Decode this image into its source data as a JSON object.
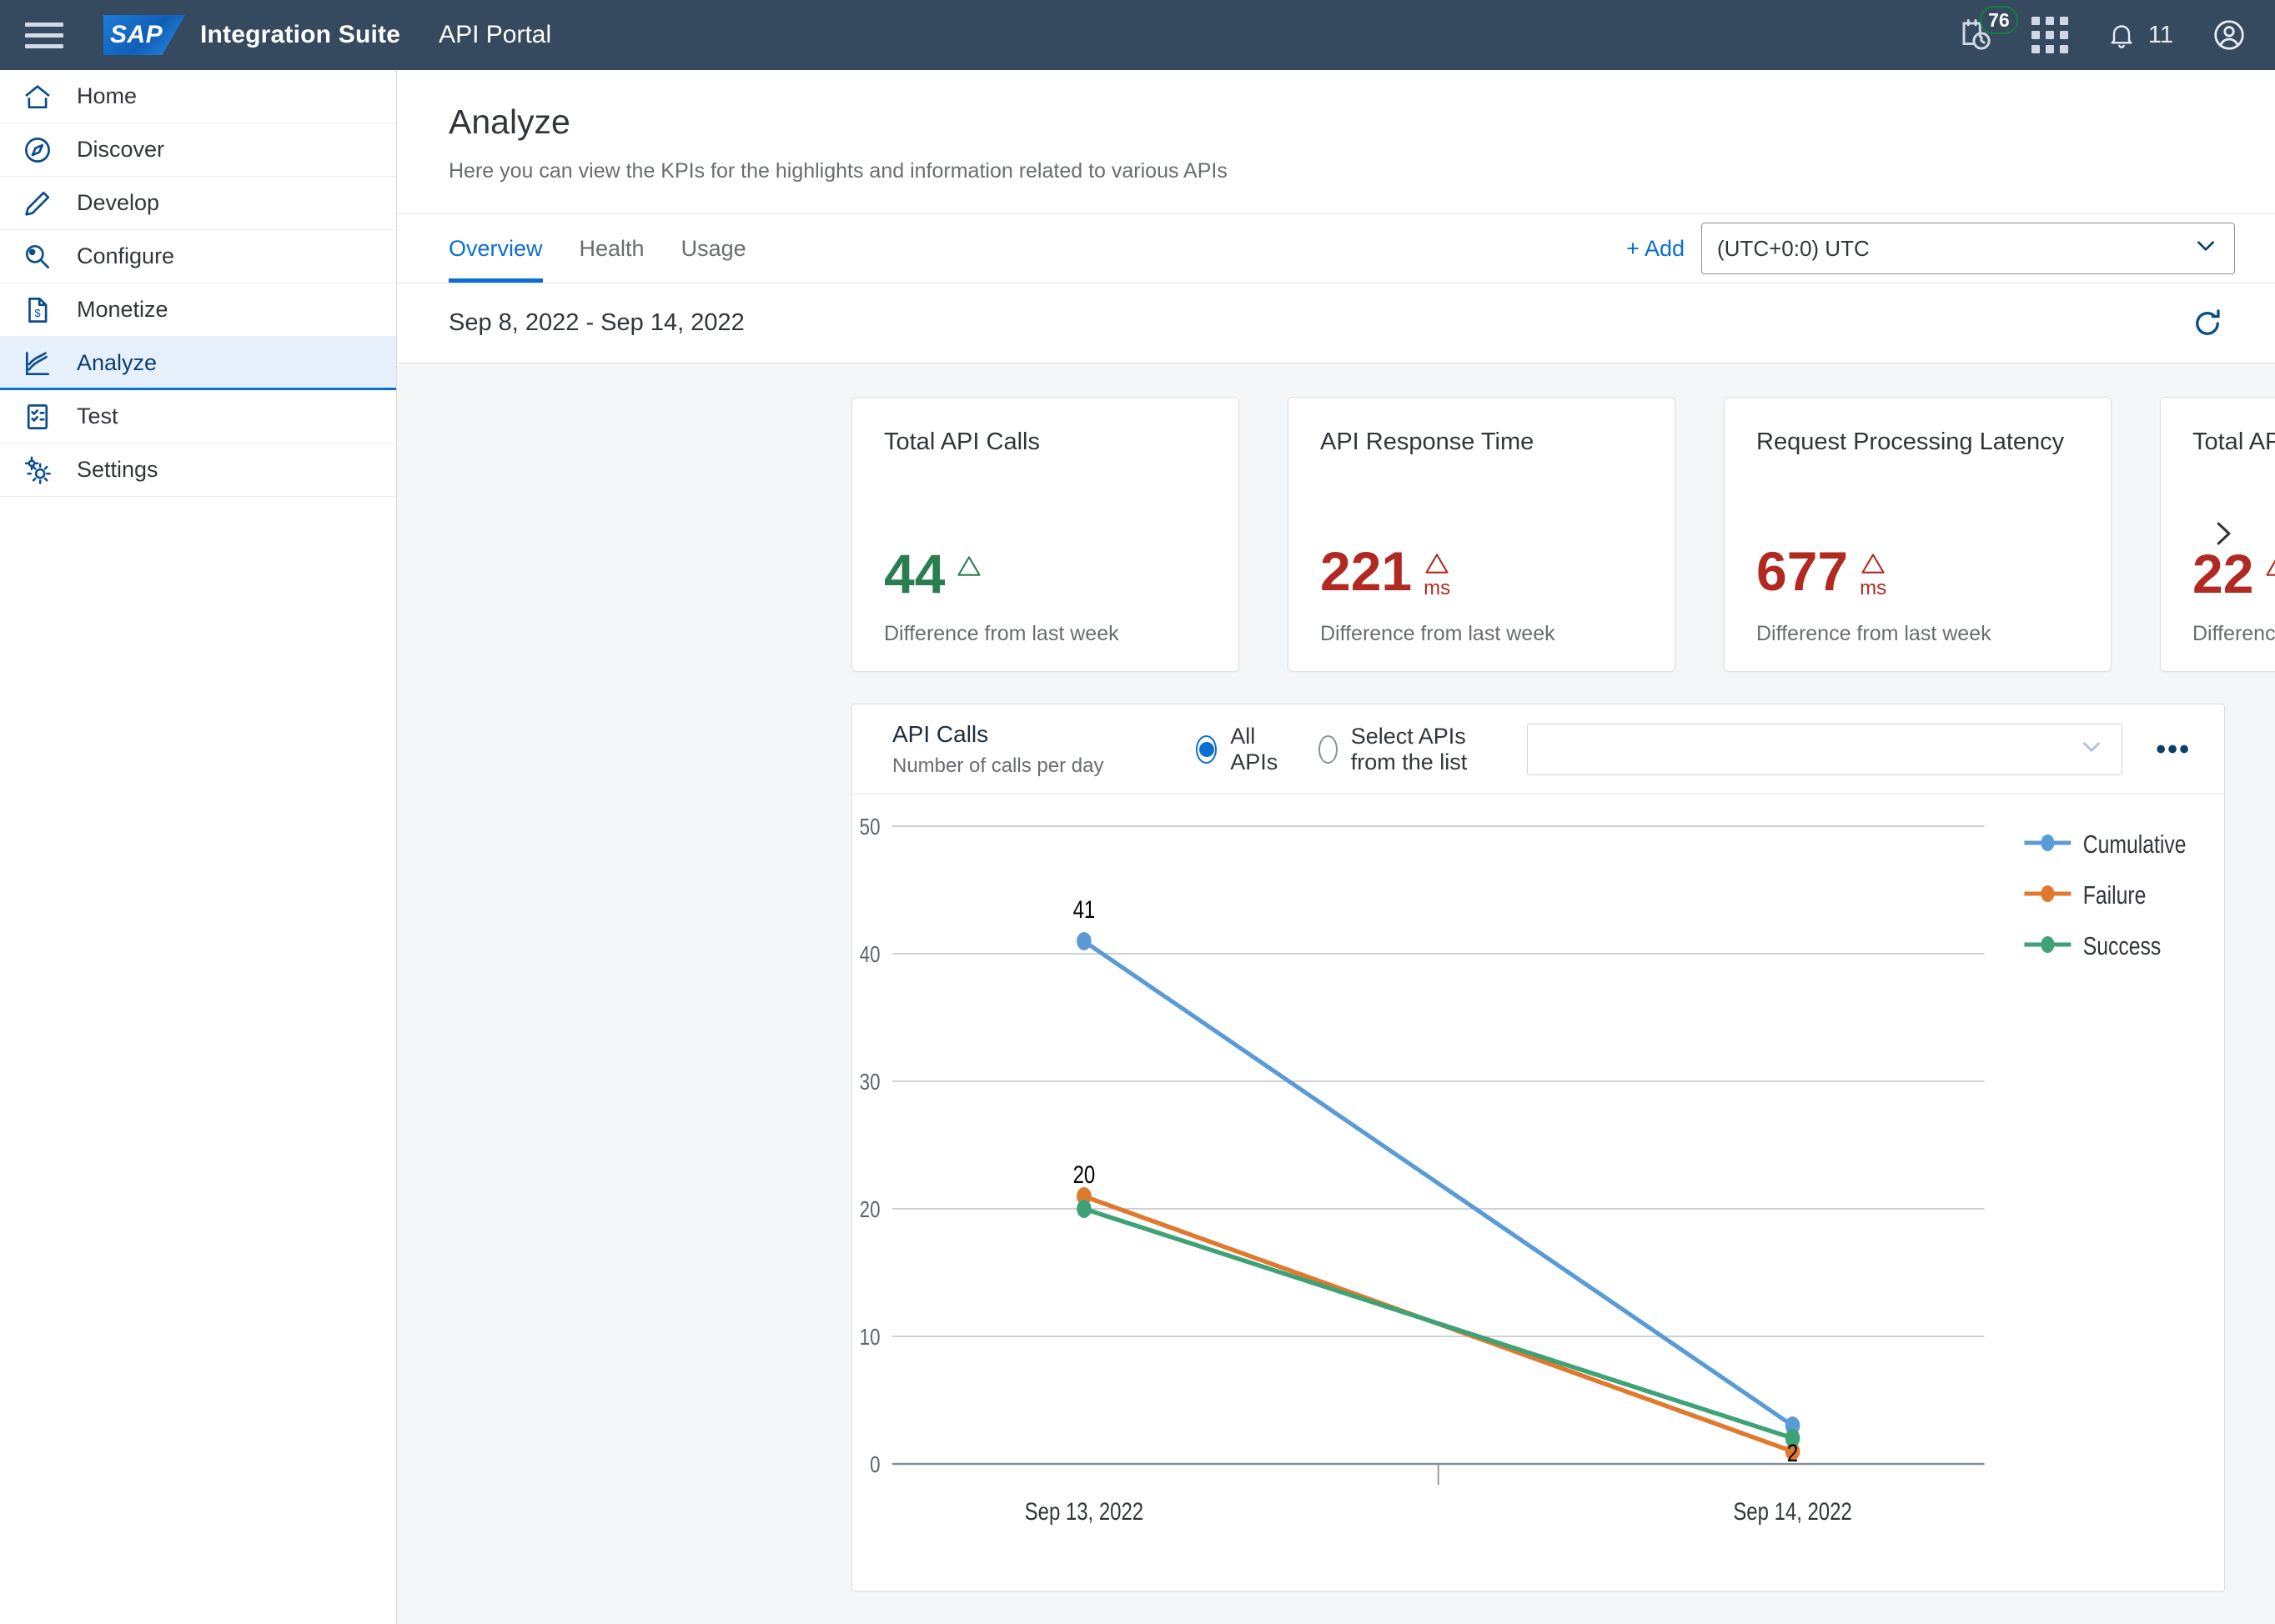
{
  "header": {
    "menu_icon": "hamburger-menu-icon",
    "logo_text": "SAP",
    "product": "Integration Suite",
    "section": "API Portal",
    "schedule_badge": "76",
    "schedule_icon": "calendar-clock-icon",
    "apps_icon": "app-grid-icon",
    "notifications_icon": "bell-icon",
    "notifications_count": "11",
    "account_icon": "user-avatar-icon"
  },
  "sidebar": {
    "items": [
      {
        "label": "Home",
        "icon": "home-icon",
        "active": false
      },
      {
        "label": "Discover",
        "icon": "compass-icon",
        "active": false
      },
      {
        "label": "Develop",
        "icon": "pencil-icon",
        "active": false
      },
      {
        "label": "Configure",
        "icon": "magnifier-gear-icon",
        "active": false
      },
      {
        "label": "Monetize",
        "icon": "document-dollar-icon",
        "active": false
      },
      {
        "label": "Analyze",
        "icon": "line-chart-icon",
        "active": true
      },
      {
        "label": "Test",
        "icon": "checklist-icon",
        "active": false
      },
      {
        "label": "Settings",
        "icon": "gears-icon",
        "active": false
      }
    ]
  },
  "page": {
    "title": "Analyze",
    "subtitle": "Here you can view the KPIs for the highlights and information related to various APIs",
    "tabs": [
      {
        "label": "Overview",
        "active": true
      },
      {
        "label": "Health",
        "active": false
      },
      {
        "label": "Usage",
        "active": false
      }
    ],
    "add_label": "+ Add",
    "timezone": "(UTC+0:0) UTC",
    "timezone_chevron": "chevron-down-icon",
    "date_range": "Sep 8, 2022 - Sep 14, 2022",
    "refresh_icon": "refresh-icon",
    "kpi_next_icon": "chevron-right-icon"
  },
  "kpis": [
    {
      "title": "Total API Calls",
      "value": "44",
      "unit": "",
      "trend": "up-triangle-icon",
      "color": "#2a7d4f",
      "footer": "Difference from last week"
    },
    {
      "title": "API Response Time",
      "value": "221",
      "unit": "ms",
      "trend": "up-triangle-icon",
      "color": "#b02a22",
      "footer": "Difference from last week"
    },
    {
      "title": "Request Processing Latency",
      "value": "677",
      "unit": "ms",
      "trend": "up-triangle-icon",
      "color": "#b02a22",
      "footer": "Difference from last week"
    },
    {
      "title": "Total API Errors",
      "value": "22",
      "unit": "",
      "trend": "up-triangle-icon",
      "color": "#b02a22",
      "footer": "Difference from last week"
    }
  ],
  "chart_card": {
    "title": "API Calls",
    "subtitle": "Number of calls per day",
    "radio_all": "All APIs",
    "radio_select": "Select APIs from the list",
    "selected_radio": "All APIs",
    "api_select_value": "",
    "api_select_chevron": "chevron-down-icon",
    "more_icon": "overflow-menu-icon"
  },
  "chart_data": {
    "type": "line",
    "title": "API Calls",
    "subtitle": "Number of calls per day",
    "xlabel": "",
    "ylabel": "",
    "categories": [
      "Sep 13, 2022",
      "Sep 14, 2022"
    ],
    "ylim": [
      0,
      50
    ],
    "yticks": [
      0,
      10,
      20,
      30,
      40,
      50
    ],
    "grid": true,
    "legend_position": "right",
    "series": [
      {
        "name": "Cumulative",
        "color": "#5b9bd5",
        "values": [
          41,
          3
        ],
        "labels": [
          "41",
          ""
        ]
      },
      {
        "name": "Failure",
        "color": "#e0792e",
        "values": [
          21,
          1
        ],
        "labels": [
          "",
          "2"
        ]
      },
      {
        "name": "Success",
        "color": "#3fa176",
        "values": [
          20,
          2
        ],
        "labels": [
          "20",
          ""
        ]
      }
    ]
  }
}
